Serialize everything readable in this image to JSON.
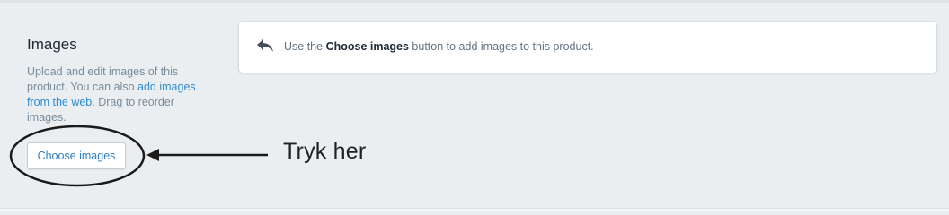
{
  "section": {
    "title": "Images",
    "description_start": "Upload and edit images of this product. You can also ",
    "description_link": "add images from the web",
    "description_end": ". Drag to reorder images.",
    "button_label": "Choose images"
  },
  "hint": {
    "icon": "reply-arrow-icon",
    "prefix": "Use the ",
    "bold": "Choose images",
    "suffix": " button to add images to this product."
  },
  "annotation": {
    "text": "Tryk her"
  },
  "colors": {
    "background": "#ebeef0",
    "link": "#2e8ccf",
    "button_text": "#2e7fbf",
    "annotation": "#222222"
  }
}
